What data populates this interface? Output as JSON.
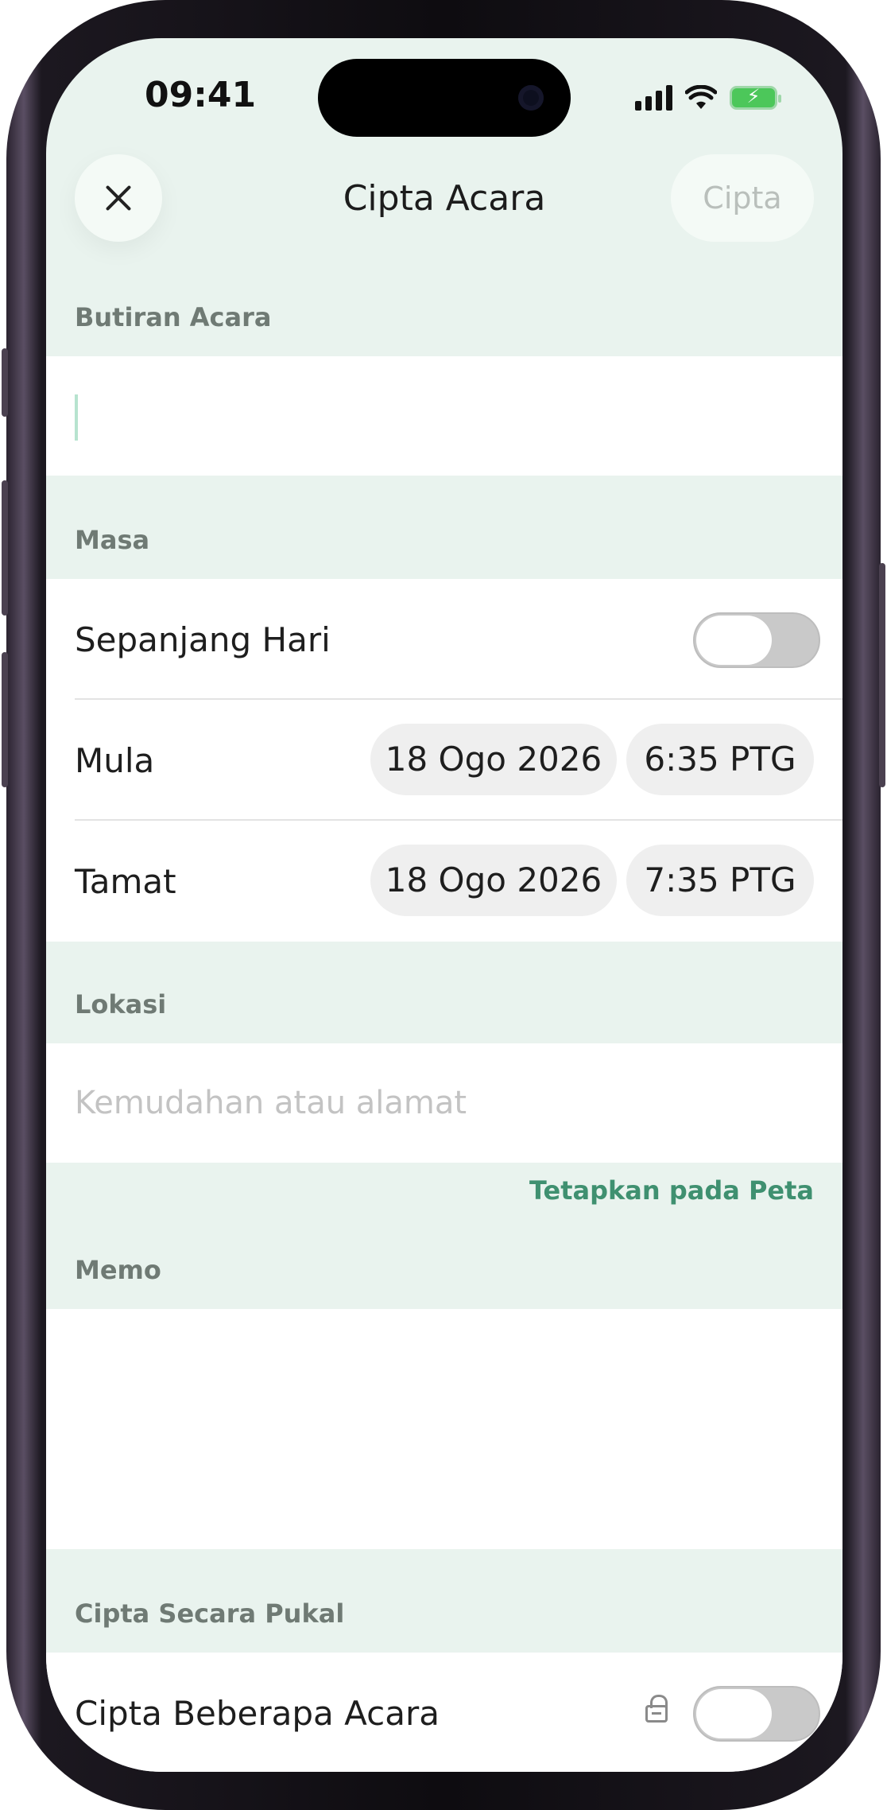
{
  "status_bar": {
    "time": "09:41"
  },
  "header": {
    "title": "Cipta Acara",
    "create_label": "Cipta",
    "close_icon": "close-icon"
  },
  "sections": {
    "details": {
      "label": "Butiran Acara",
      "value": ""
    },
    "time": {
      "label": "Masa",
      "all_day_label": "Sepanjang Hari",
      "all_day_on": false,
      "start_label": "Mula",
      "start_date": "18 Ogo 2026",
      "start_time": "6:35 PTG",
      "end_label": "Tamat",
      "end_date": "18 Ogo 2026",
      "end_time": "7:35 PTG"
    },
    "location": {
      "label": "Lokasi",
      "placeholder": "Kemudahan atau alamat",
      "map_link": "Tetapkan pada Peta"
    },
    "memo": {
      "label": "Memo",
      "value": ""
    },
    "bulk": {
      "label": "Cipta Secara Pukal",
      "multiple_label": "Cipta Beberapa Acara",
      "multiple_on": false,
      "lock_icon": "lock-icon"
    }
  },
  "colors": {
    "accent": "#3f9070",
    "section_bg": "#e9f3ee"
  }
}
